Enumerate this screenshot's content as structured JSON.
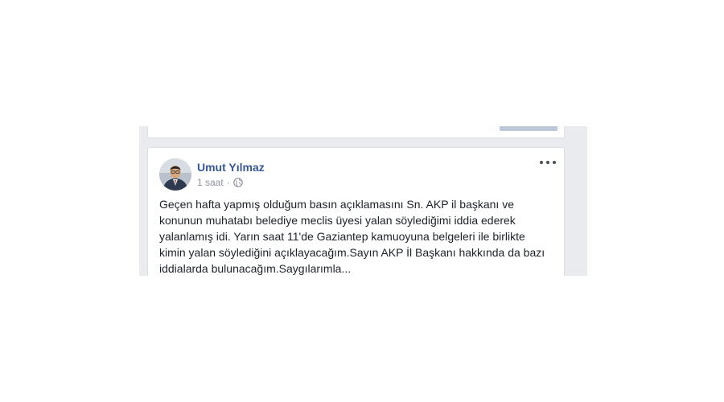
{
  "post": {
    "author": "Umut Yılmaz",
    "time": "1 saat",
    "separator": "·",
    "privacy_icon": "globe-icon",
    "menu_icon": "more-options-icon",
    "text": "Geçen hafta yapmış olduğum basın açıklamasını Sn. AKP il başkanı ve konunun muhatabı belediye meclis üyesi yalan söylediğimi iddia ederek yalanlamış idi. Yarın saat 11'de Gaziantep kamuoyuna belgeleri ile birlikte kimin yalan söylediğini açıklayacağım.Sayın AKP İl Başkanı hakkında da bazı iddialarda bulunacağım.Saygılarımla..."
  },
  "colors": {
    "feed_background": "#e9ebee",
    "author_link": "#365899",
    "meta_text": "#90949c",
    "body_text": "#1d2129"
  }
}
